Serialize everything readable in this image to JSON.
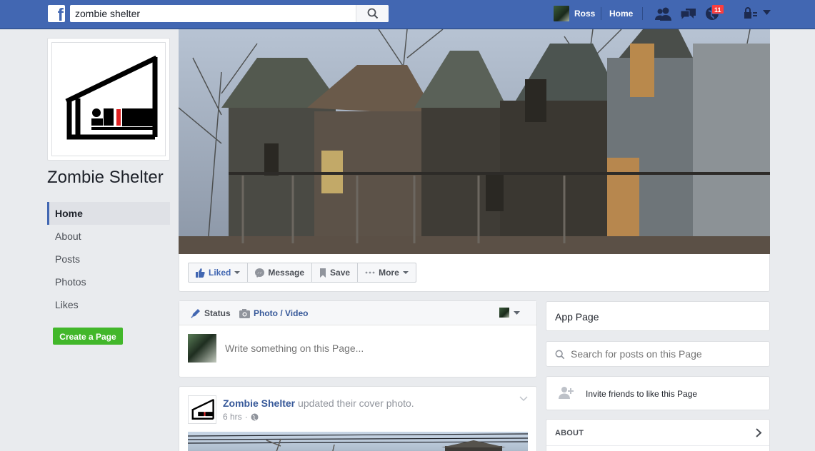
{
  "topbar": {
    "logo_letter": "f",
    "search_value": "zombie shelter",
    "user_name": "Ross",
    "home_label": "Home",
    "notification_count": "11"
  },
  "page": {
    "name": "Zombie Shelter"
  },
  "left_nav": {
    "items": [
      {
        "label": "Home"
      },
      {
        "label": "About"
      },
      {
        "label": "Posts"
      },
      {
        "label": "Photos"
      },
      {
        "label": "Likes"
      }
    ],
    "create_page_label": "Create a Page"
  },
  "actions": {
    "liked": "Liked",
    "message": "Message",
    "save": "Save",
    "more": "More"
  },
  "composer": {
    "status_tab": "Status",
    "photo_tab": "Photo / Video",
    "placeholder": "Write something on this Page..."
  },
  "post": {
    "author": "Zombie Shelter",
    "action": " updated their cover photo.",
    "time": "6 hrs"
  },
  "right": {
    "app_page": "App Page",
    "search_placeholder": "Search for posts on this Page",
    "invite_label": "Invite friends to like this Page",
    "about_header": "ABOUT"
  },
  "colors": {
    "brand": "#4267b2",
    "link": "#365899",
    "create_button": "#42b72a",
    "badge": "#fa3e3e"
  },
  "icons": [
    "search-icon",
    "friends-icon",
    "messages-icon",
    "globe-icon",
    "lock-icon",
    "like-icon",
    "messenger-icon",
    "bookmark-icon",
    "dots-icon",
    "pencil-icon",
    "camera-icon",
    "add-friend-icon",
    "chevron-right-icon"
  ]
}
